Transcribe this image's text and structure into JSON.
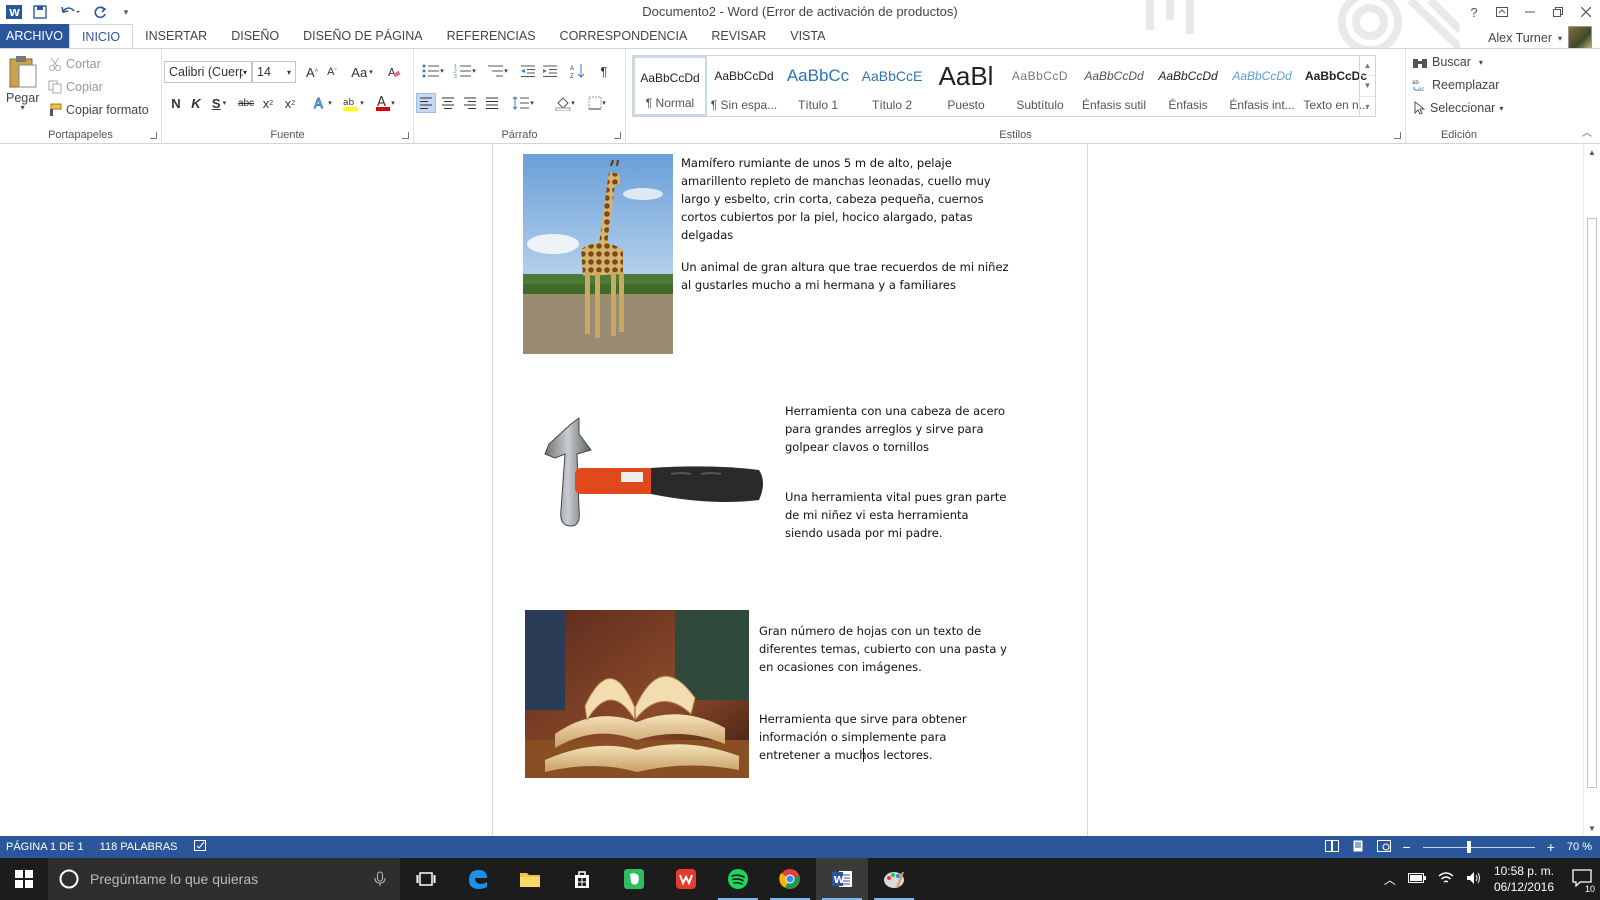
{
  "window": {
    "title": "Documento2 - Word (Error de activación de productos)",
    "help": "?",
    "user": "Alex Turner"
  },
  "tabs": [
    "ARCHIVO",
    "INICIO",
    "INSERTAR",
    "DISEÑO",
    "DISEÑO DE PÁGINA",
    "REFERENCIAS",
    "CORRESPONDENCIA",
    "REVISAR",
    "VISTA"
  ],
  "ribbon": {
    "clipboard": {
      "label": "Portapapeles",
      "paste": "Pegar",
      "cut": "Cortar",
      "copy": "Copiar",
      "format_painter": "Copiar formato"
    },
    "font": {
      "label": "Fuente",
      "font_name": "Calibri (Cuerp",
      "font_size": "14",
      "bold": "N",
      "italic": "K",
      "underline": "S",
      "strike": "abc",
      "change_case": "Aa"
    },
    "paragraph": {
      "label": "Párrafo",
      "pilcrow": "¶"
    },
    "styles": {
      "label": "Estilos",
      "items": [
        {
          "preview": "AaBbCcDd",
          "name": "¶ Normal"
        },
        {
          "preview": "AaBbCcDd",
          "name": "¶ Sin espa..."
        },
        {
          "preview": "AaBbCc",
          "name": "Título 1"
        },
        {
          "preview": "AaBbCcE",
          "name": "Título 2"
        },
        {
          "preview": "AaBl",
          "name": "Puesto"
        },
        {
          "preview": "AaBbCcD",
          "name": "Subtítulo"
        },
        {
          "preview": "AaBbCcDd",
          "name": "Énfasis sutil"
        },
        {
          "preview": "AaBbCcDd",
          "name": "Énfasis"
        },
        {
          "preview": "AaBbCcDd",
          "name": "Énfasis int..."
        },
        {
          "preview": "AaBbCcDc",
          "name": "Texto en n..."
        }
      ]
    },
    "editing": {
      "label": "Edición",
      "find": "Buscar",
      "replace": "Reemplazar",
      "select": "Seleccionar"
    }
  },
  "document": {
    "giraffe_desc": "Mamífero rumiante de unos 5 m de alto, pelaje amarillento repleto de manchas leonadas, cuello muy largo y esbelto, crin corta, cabeza pequeña, cuernos cortos cubiertos por la piel, hocico alargado, patas delgadas",
    "giraffe_memory": "Un animal de gran altura que trae recuerdos de mi niñez al gustarles mucho a mi hermana y a familiares",
    "hammer_desc": "Herramienta con una cabeza de acero para grandes arreglos y sirve para golpear clavos o tornillos",
    "hammer_memory": "Una herramienta vital pues gran parte de mi niñez vi esta herramienta siendo usada por mi padre.",
    "book_desc": "Gran número de hojas con un texto de diferentes temas, cubierto con una pasta y en ocasiones con imágenes.",
    "book_memory": "Herramienta que sirve para obtener información o simplemente para entretener a muchos lectores."
  },
  "statusbar": {
    "page": "PÁGINA 1 DE 1",
    "words": "118 PALABRAS",
    "zoom": "70 %",
    "zoom_level_percent": 70
  },
  "taskbar": {
    "search_placeholder": "Pregúntame lo que quieras",
    "time": "10:58 p. m.",
    "date": "06/12/2016",
    "notifications": "10"
  }
}
